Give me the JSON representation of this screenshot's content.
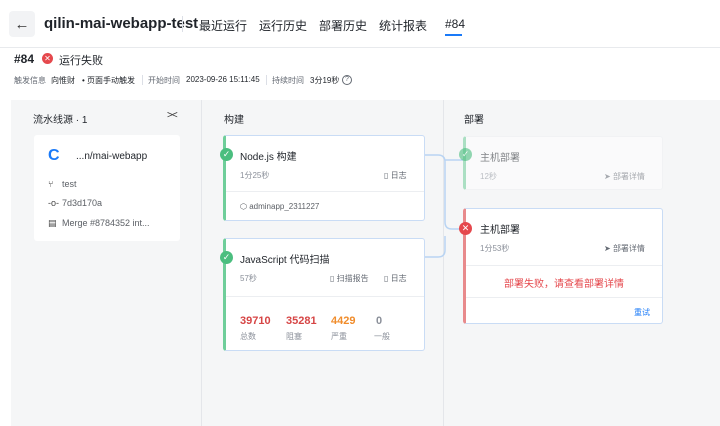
{
  "header": {
    "back_label": "←",
    "app_title": "qilin-mai-webapp-test",
    "tabs": [
      "最近运行",
      "运行历史",
      "部署历史",
      "统计报表",
      "#84"
    ],
    "active_tab": "#84"
  },
  "run": {
    "id": "#84",
    "status": "运行失败",
    "trigger_label": "触发信息",
    "trigger_user": "向惟财",
    "trigger_mode": "• 页面手动触发",
    "start_label": "开始时间",
    "start_time": "2023-09-26 15:11:45",
    "duration_label": "持续时间",
    "duration": "3分19秒"
  },
  "columns": {
    "source_title": "流水线源 · 1",
    "build_title": "构建",
    "deploy_title": "部署"
  },
  "source": {
    "name": "...n/mai-webapp",
    "branch": "test",
    "commit": "7d3d170a",
    "message": "Merge #8784352 int..."
  },
  "build_jobs": [
    {
      "name": "Node.js 构建",
      "duration": "1分25秒",
      "log_label": "日志",
      "artifact": "adminapp_2311227"
    },
    {
      "name": "JavaScript 代码扫描",
      "duration": "57秒",
      "report_label": "扫描报告",
      "log_label": "日志",
      "stats": [
        {
          "value": "39710",
          "label": "总数",
          "color": "#d64545"
        },
        {
          "value": "35281",
          "label": "阻塞",
          "color": "#d64545"
        },
        {
          "value": "4429",
          "label": "严重",
          "color": "#f08c2b"
        },
        {
          "value": "0",
          "label": "一般",
          "color": "#8a8f99"
        }
      ]
    }
  ],
  "deploy_jobs": [
    {
      "name": "主机部署",
      "duration": "12秒",
      "detail_label": "部署详情"
    },
    {
      "name": "主机部署",
      "duration": "1分53秒",
      "detail_label": "部署详情",
      "fail_message": "部署失败，请查看部署详情",
      "retry_label": "重试"
    }
  ],
  "colors": {
    "accent": "#1a7af8",
    "success": "#4bbe7f",
    "failure": "#e5484d"
  }
}
